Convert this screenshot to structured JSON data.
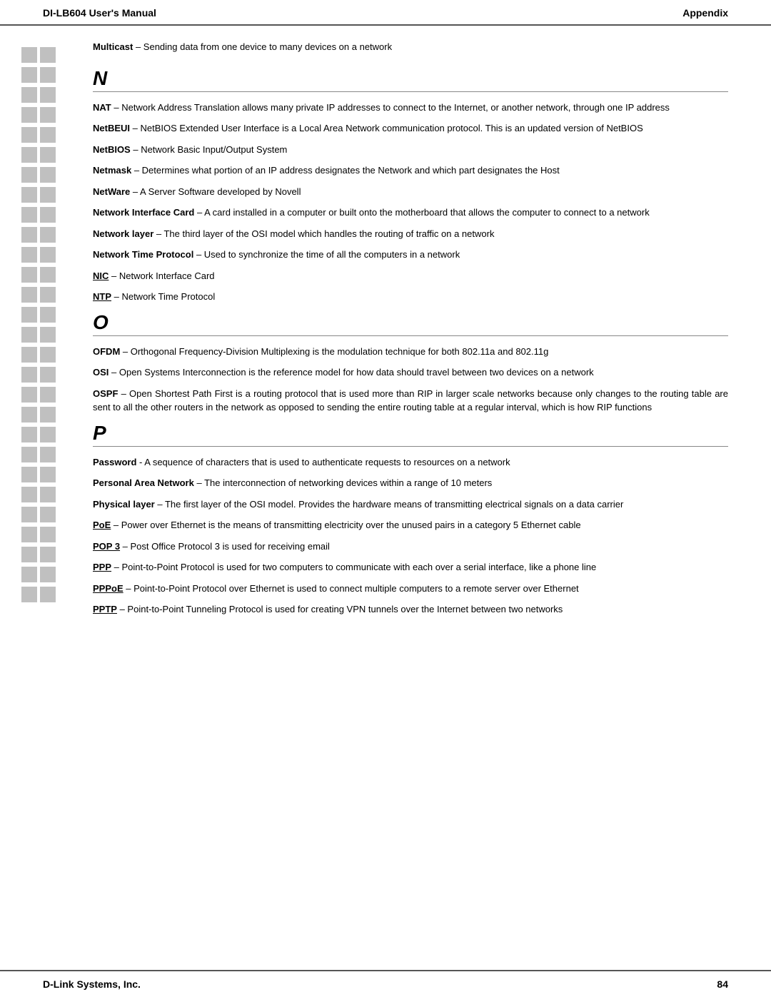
{
  "header": {
    "left": "DI-LB604 User's Manual",
    "right": "Appendix"
  },
  "footer": {
    "left": "D-Link Systems, Inc.",
    "right": "84"
  },
  "intro": {
    "text": "Multicast – Sending data from one device to many devices on a network"
  },
  "sections": [
    {
      "letter": "N",
      "terms": [
        {
          "id": "nat",
          "bold": "NAT",
          "definition": " – Network Address Translation allows many private IP addresses to connect to the Internet, or another network, through one IP address"
        },
        {
          "id": "netbeui",
          "bold": "NetBEUI",
          "definition": " – NetBIOS Extended User Interface is a Local Area Network communication protocol.  This is an updated version of NetBIOS"
        },
        {
          "id": "netbios",
          "bold": "NetBIOS",
          "definition": " – Network Basic Input/Output System"
        },
        {
          "id": "netmask",
          "bold": "Netmask",
          "definition": " – Determines what portion of an IP address designates the Network and which part designates the Host"
        },
        {
          "id": "netware",
          "bold": "NetWare",
          "definition": " – A Server Software developed by Novell"
        },
        {
          "id": "nic-full",
          "bold": "Network Interface Card",
          "definition": " – A card installed in a computer or built onto the motherboard that allows the computer to connect to a network"
        },
        {
          "id": "network-layer",
          "bold": "Network layer",
          "definition": " – The third layer of the OSI model which handles the routing of traffic on a network"
        },
        {
          "id": "ntp-full",
          "bold": "Network Time Protocol",
          "definition": " – Used to synchronize the time of all the computers in a network"
        },
        {
          "id": "nic-abbr",
          "bold": "NIC",
          "definition": " – Network Interface Card"
        },
        {
          "id": "ntp-abbr",
          "bold": "NTP",
          "definition": " – Network Time Protocol"
        }
      ]
    },
    {
      "letter": "O",
      "terms": [
        {
          "id": "ofdm",
          "bold": "OFDM",
          "definition": " – Orthogonal Frequency-Division Multiplexing is the modulation technique for both 802.11a and 802.11g"
        },
        {
          "id": "osi",
          "bold": "OSI",
          "definition": " – Open Systems Interconnection is the reference model for how data should travel between two devices on a network"
        },
        {
          "id": "ospf",
          "bold": "OSPF",
          "definition": " – Open Shortest Path First is a routing protocol that is used more than RIP in larger scale networks because only changes to the routing table are sent to all the other routers in the network as opposed to sending the entire routing table at a regular interval, which is how RIP functions"
        }
      ]
    },
    {
      "letter": "P",
      "terms": [
        {
          "id": "password",
          "bold": "Password",
          "definition": " -  A sequence of characters that is used to authenticate requests to resources on a network"
        },
        {
          "id": "pan",
          "bold": "Personal Area Network",
          "definition": " – The interconnection of networking devices within a range of 10 meters"
        },
        {
          "id": "physical-layer",
          "bold": "Physical layer",
          "definition": " – The first layer of the OSI model.  Provides the hardware means of transmitting electrical signals on a data carrier"
        },
        {
          "id": "poe",
          "bold": "PoE",
          "definition": " – Power over Ethernet is the means of transmitting electricity over the unused pairs in a category 5 Ethernet cable"
        },
        {
          "id": "pop3",
          "bold": "POP 3",
          "definition": " – Post Office Protocol 3 is used for receiving email"
        },
        {
          "id": "ppp",
          "bold": "PPP",
          "definition": " – Point-to-Point Protocol is used for two computers to communicate with each over a serial interface, like a phone line"
        },
        {
          "id": "pppoe",
          "bold": "PPPoE",
          "definition": " – Point-to-Point Protocol over Ethernet is used to connect multiple computers to a remote server over Ethernet"
        },
        {
          "id": "pptp",
          "bold": "PPTP",
          "definition": " – Point-to-Point Tunneling Protocol is used for creating VPN tunnels over the Internet between two networks"
        }
      ]
    }
  ],
  "sidebar_rows": 28
}
